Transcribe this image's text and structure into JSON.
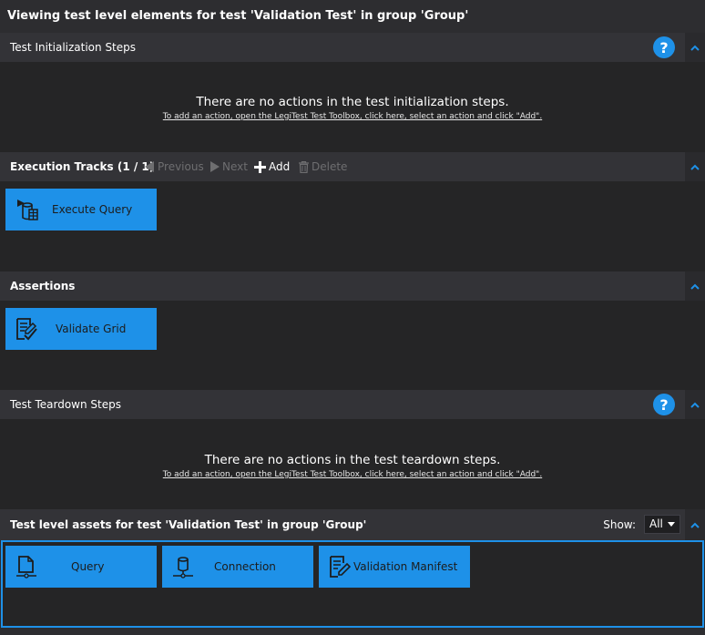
{
  "page_title": "Viewing test level elements for test 'Validation Test' in group 'Group'",
  "colors": {
    "accent": "#1e91e8",
    "header_bg": "#333337",
    "body_bg": "#252526"
  },
  "init": {
    "label": "Test Initialization Steps",
    "help_glyph": "?",
    "empty_message": "There are no actions in the test initialization steps.",
    "empty_hint": "To add an action, open the LegiTest Test Toolbox, click here, select an action and click \"Add\"."
  },
  "tracks": {
    "label": "Execution Tracks (1 / 1)",
    "previous": "Previous",
    "next": "Next",
    "add": "Add",
    "delete": "Delete",
    "items": [
      {
        "label": "Execute Query",
        "icon": "execute-query-icon"
      }
    ]
  },
  "assertions": {
    "label": "Assertions",
    "items": [
      {
        "label": "Validate Grid",
        "icon": "validate-grid-icon"
      }
    ]
  },
  "teardown": {
    "label": "Test Teardown Steps",
    "help_glyph": "?",
    "empty_message": "There are no actions in the test teardown steps.",
    "empty_hint": "To add an action, open the LegiTest Test Toolbox, click here, select an action and click \"Add\"."
  },
  "assets": {
    "label": "Test level assets for test 'Validation Test' in group 'Group'",
    "show_label": "Show:",
    "show_value": "All",
    "items": [
      {
        "label": "Query",
        "icon": "query-icon"
      },
      {
        "label": "Connection",
        "icon": "connection-icon"
      },
      {
        "label": "Validation Manifest",
        "icon": "validation-manifest-icon"
      }
    ]
  }
}
